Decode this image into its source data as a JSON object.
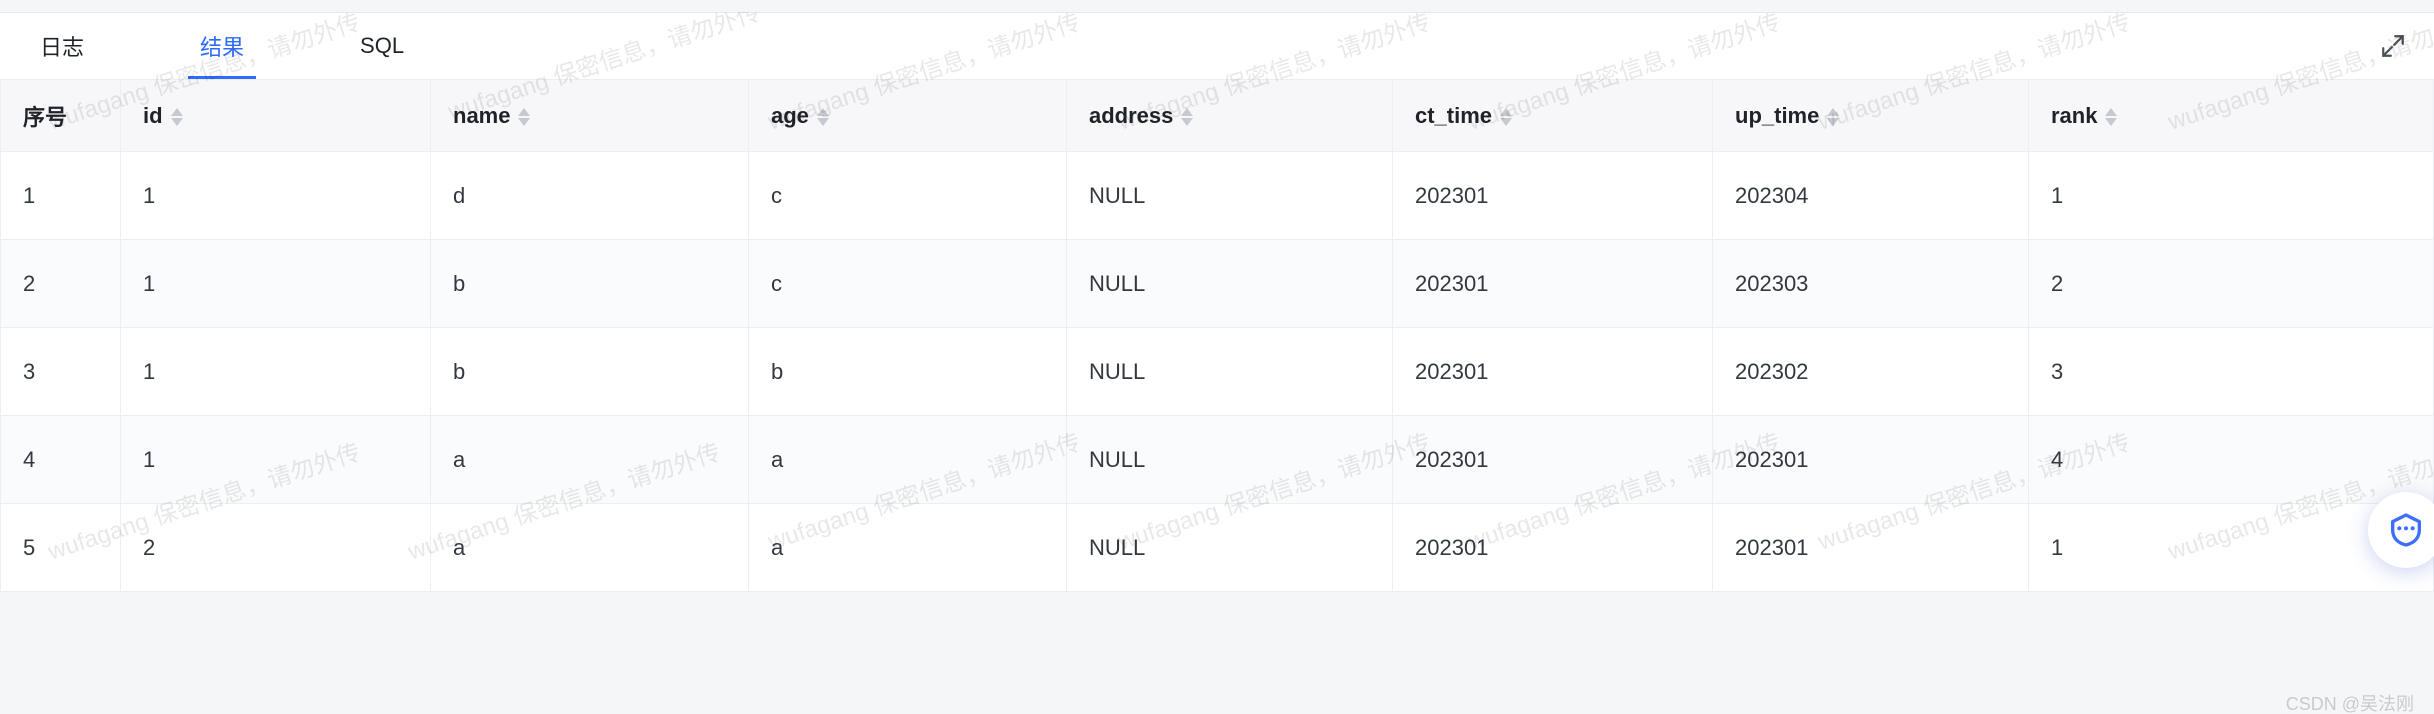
{
  "tabs": {
    "log": "日志",
    "result": "结果",
    "sql": "SQL",
    "active": "result"
  },
  "columns": {
    "seq": "序号",
    "id": "id",
    "name": "name",
    "age": "age",
    "address": "address",
    "ct_time": "ct_time",
    "up_time": "up_time",
    "rank": "rank"
  },
  "rows": [
    {
      "seq": "1",
      "id": "1",
      "name": "d",
      "age": "c",
      "address": "NULL",
      "ct_time": "202301",
      "up_time": "202304",
      "rank": "1"
    },
    {
      "seq": "2",
      "id": "1",
      "name": "b",
      "age": "c",
      "address": "NULL",
      "ct_time": "202301",
      "up_time": "202303",
      "rank": "2"
    },
    {
      "seq": "3",
      "id": "1",
      "name": "b",
      "age": "b",
      "address": "NULL",
      "ct_time": "202301",
      "up_time": "202302",
      "rank": "3"
    },
    {
      "seq": "4",
      "id": "1",
      "name": "a",
      "age": "a",
      "address": "NULL",
      "ct_time": "202301",
      "up_time": "202301",
      "rank": "4"
    },
    {
      "seq": "5",
      "id": "2",
      "name": "a",
      "age": "a",
      "address": "NULL",
      "ct_time": "202301",
      "up_time": "202301",
      "rank": "1"
    }
  ],
  "watermark_text": "wufagang 保密信息，请勿外传",
  "footer_credit": "CSDN @吴法刚"
}
